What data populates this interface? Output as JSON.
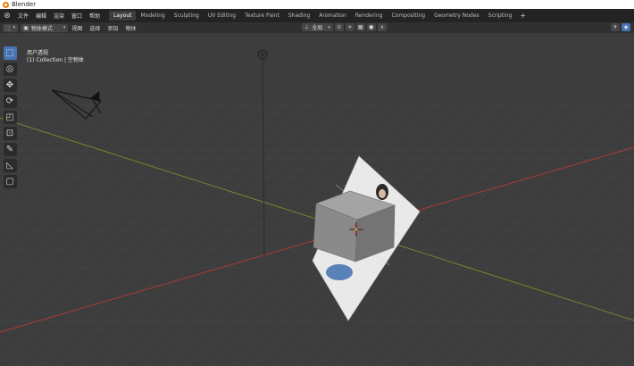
{
  "window": {
    "title": "Blender"
  },
  "menu": {
    "items": [
      "文件",
      "编辑",
      "渲染",
      "窗口",
      "帮助"
    ]
  },
  "workspaces": {
    "tabs": [
      "Layout",
      "Modeling",
      "Sculpting",
      "UV Editing",
      "Texture Paint",
      "Shading",
      "Animation",
      "Rendering",
      "Compositing",
      "Geometry Nodes",
      "Scripting"
    ],
    "active": "Layout"
  },
  "header": {
    "mode": "物体模式",
    "menus": [
      "视图",
      "选择",
      "添加",
      "物体"
    ],
    "transform_orientation": "全局"
  },
  "viewport": {
    "view_name": "用户透视",
    "collection_info": "(1) Collection | 空物体"
  },
  "colors": {
    "accent": "#4772b3",
    "x_axis": "#9b3a3a",
    "y_axis": "#6d8a2a",
    "grid_bg": "#3d3d3d",
    "cube": "#8a8a8a"
  },
  "icons": {
    "toolbar": [
      "select-box-icon",
      "cursor-icon",
      "move-icon",
      "rotate-icon",
      "scale-icon",
      "transform-icon",
      "annotate-icon",
      "measure-icon",
      "add-cube-icon"
    ]
  }
}
